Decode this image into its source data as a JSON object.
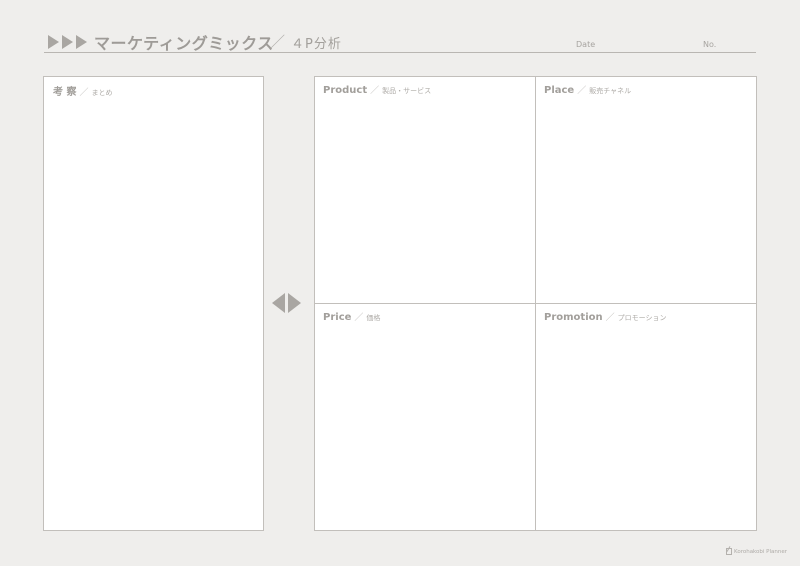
{
  "header": {
    "title": "マーケティングミックス",
    "separator": "／",
    "subtitle": "４P分析",
    "date_label": "Date",
    "no_label": "No."
  },
  "left_box": {
    "label": "考 察",
    "separator": "／",
    "sub": "まとめ"
  },
  "quadrants": {
    "product": {
      "label": "Product",
      "separator": "／",
      "sub": "製品・サービス"
    },
    "place": {
      "label": "Place",
      "separator": "／",
      "sub": "販売チャネル"
    },
    "price": {
      "label": "Price",
      "separator": "／",
      "sub": "価格"
    },
    "promotion": {
      "label": "Promotion",
      "separator": "／",
      "sub": "プロモーション"
    }
  },
  "footer": {
    "brand": "Korohakobi Planner"
  }
}
